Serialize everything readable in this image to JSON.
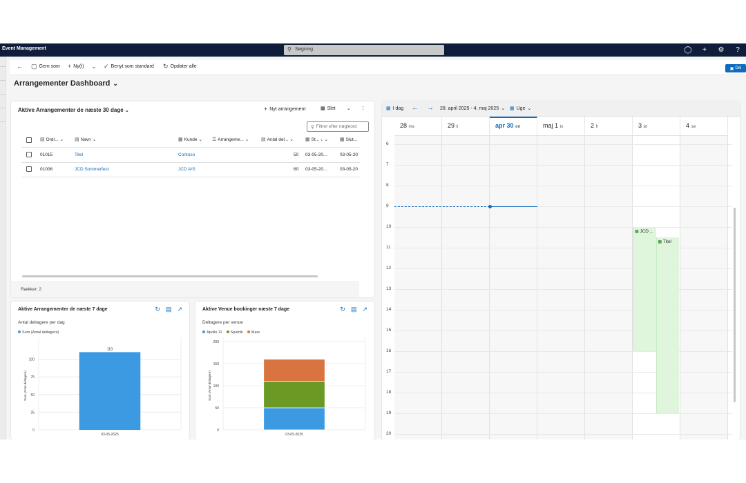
{
  "app": {
    "title": "Event Management",
    "search_placeholder": "Søgning",
    "top_icons": [
      "lightbulb-icon",
      "plus-icon",
      "gear-icon",
      "help-icon"
    ]
  },
  "commandbar": {
    "save_label": "Gem som",
    "new_label": "Ny(t)",
    "set_default_label": "Benyt som standard",
    "refresh_label": "Opdater alle",
    "share_label": "Del"
  },
  "dashboard": {
    "title": "Arrangementer Dashboard"
  },
  "grid": {
    "title": "Aktive Arrangementer de næste 30 dage",
    "new_event_label": "Nyt arrangement",
    "delete_label": "Slet",
    "filter_placeholder": "Filtrer efter nøgleord",
    "columns": [
      "Ordr...",
      "Navn",
      "Kunde",
      "Arrangeme...",
      "Antal del...",
      "St...",
      "Slut..."
    ],
    "rows": [
      {
        "order": "01015",
        "name": "Titel",
        "customer": "Contoso",
        "count": "50",
        "start": "03-05-20...",
        "end": "03-05-20"
      },
      {
        "order": "01006",
        "name": "JCD Sommerfest",
        "customer": "JCD A/S",
        "count": "60",
        "start": "03-05-20...",
        "end": "03-05-20"
      }
    ],
    "footer": "Rækker: 2"
  },
  "charts": [
    {
      "title": "Aktive Arrangementer de næste 7 dage",
      "subtitle": "Antal deltagere per dag",
      "chart_data": {
        "type": "bar",
        "categories": [
          "03-05-2025"
        ],
        "series": [
          {
            "name": "Sum (Antal deltagere)",
            "values": [
              110
            ],
            "color": "#3b9ae1"
          }
        ],
        "ylabel": "Sum (Antal deltagere)",
        "ylim": [
          0,
          125
        ],
        "yticks": [
          0,
          25,
          50,
          75,
          100
        ],
        "data_labels": true,
        "grid": true,
        "legend": "top-left"
      }
    },
    {
      "title": "Aktive Venue bookinger næste 7 dage",
      "subtitle": "Deltagere per venue",
      "chart_data": {
        "type": "bar",
        "stacked": true,
        "categories": [
          "03-05-2025"
        ],
        "series": [
          {
            "name": "Apollo 11",
            "values": [
              50
            ],
            "color": "#3b9ae1"
          },
          {
            "name": "Sputnik",
            "values": [
              60
            ],
            "color": "#6a9a23"
          },
          {
            "name": "Mars",
            "values": [
              50
            ],
            "color": "#d97340"
          }
        ],
        "ylabel": "Sum (Antal deltagere)",
        "ylim": [
          0,
          200
        ],
        "yticks": [
          0,
          50,
          100,
          150,
          200
        ],
        "grid": true,
        "legend": "top-left"
      }
    }
  ],
  "calendar": {
    "today_label": "I dag",
    "range_label": "28. april 2025 - 4. maj 2025",
    "view_label": "Uge",
    "days": [
      {
        "num": "28",
        "name": "ma"
      },
      {
        "num": "29",
        "name": "ti"
      },
      {
        "num": "apr 30",
        "name": "on",
        "today": true
      },
      {
        "num": "maj 1",
        "name": "to"
      },
      {
        "num": "2",
        "name": "fr"
      },
      {
        "num": "3",
        "name": "lø"
      },
      {
        "num": "4",
        "name": "sø"
      }
    ],
    "hours": [
      "6",
      "7",
      "8",
      "9",
      "10",
      "11",
      "12",
      "13",
      "14",
      "15",
      "16",
      "17",
      "18",
      "19",
      "20"
    ],
    "events": [
      {
        "title": "JCD ...",
        "day": 5,
        "start": 10,
        "end": 16,
        "lane": 0
      },
      {
        "title": "Titel",
        "day": 5,
        "start": 10.5,
        "end": 19,
        "lane": 1
      }
    ],
    "now_hour": 9
  }
}
